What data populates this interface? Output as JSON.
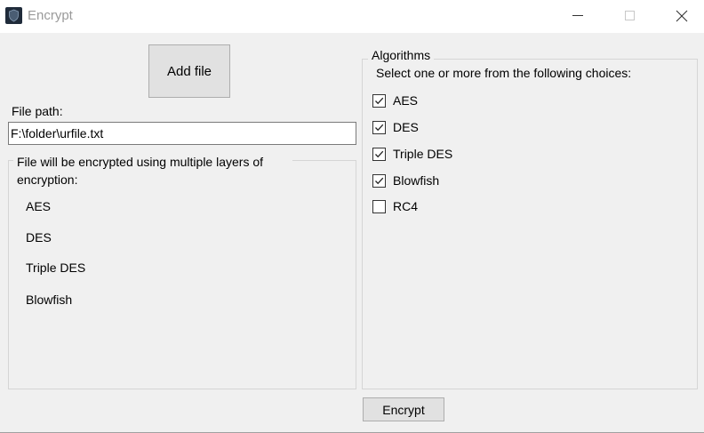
{
  "window": {
    "title": "Encrypt"
  },
  "toolbar": {
    "add_file_label": "Add file"
  },
  "file_path": {
    "label": "File path:",
    "value": "F:\\folder\\urfile.txt"
  },
  "summary": {
    "caption": "File will be encrypted using multiple layers of encryption:",
    "items": [
      "AES",
      "DES",
      "Triple DES",
      "Blowfish"
    ]
  },
  "algorithms": {
    "caption": "Algorithms",
    "instructions": "Select one or more from the following choices:",
    "options": [
      {
        "label": "AES",
        "checked": true
      },
      {
        "label": "DES",
        "checked": true
      },
      {
        "label": "Triple DES",
        "checked": true
      },
      {
        "label": "Blowfish",
        "checked": true
      },
      {
        "label": "RC4",
        "checked": false
      }
    ]
  },
  "actions": {
    "encrypt_label": "Encrypt"
  },
  "colors": {
    "window_bg": "#f0f0f0",
    "titlebar_bg": "#ffffff",
    "button_bg": "#e1e1e1"
  }
}
